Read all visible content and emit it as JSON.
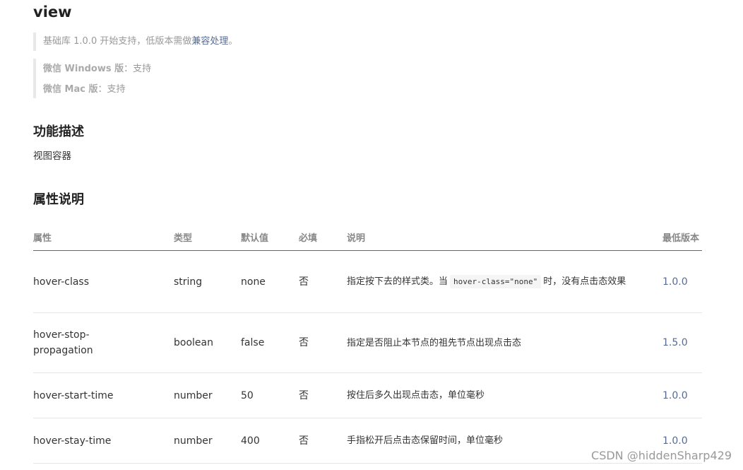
{
  "title": "view",
  "support": {
    "base_prefix": "基础库 1.0.0 开始支持，低版本需做",
    "compat_link": "兼容处理",
    "base_suffix": "。",
    "windows_label": "微信 Windows 版",
    "windows_value": "：支持",
    "mac_label": "微信 Mac 版",
    "mac_value": "：支持"
  },
  "function_heading": "功能描述",
  "function_text": "视图容器",
  "attributes_heading": "属性说明",
  "table": {
    "headers": [
      "属性",
      "类型",
      "默认值",
      "必填",
      "说明",
      "最低版本"
    ],
    "rows": [
      {
        "name": "hover-class",
        "type": "string",
        "default": "none",
        "required": "否",
        "desc_prefix": "指定按下去的样式类。当",
        "desc_code": "hover-class=\"none\"",
        "desc_suffix": "时，没有点击态效果",
        "version": "1.0.0"
      },
      {
        "name": "hover-stop-propagation",
        "type": "boolean",
        "default": "false",
        "required": "否",
        "desc_prefix": "指定是否阻止本节点的祖先节点出现点击态",
        "desc_code": "",
        "desc_suffix": "",
        "version": "1.5.0"
      },
      {
        "name": "hover-start-time",
        "type": "number",
        "default": "50",
        "required": "否",
        "desc_prefix": "按住后多久出现点击态，单位毫秒",
        "desc_code": "",
        "desc_suffix": "",
        "version": "1.0.0"
      },
      {
        "name": "hover-stay-time",
        "type": "number",
        "default": "400",
        "required": "否",
        "desc_prefix": "手指松开后点击态保留时间，单位毫秒",
        "desc_code": "",
        "desc_suffix": "",
        "version": "1.0.0"
      }
    ]
  },
  "watermark": "CSDN @hiddenSharp429",
  "colors": {
    "link": "#576b95",
    "muted": "#999999",
    "text": "#333333"
  }
}
